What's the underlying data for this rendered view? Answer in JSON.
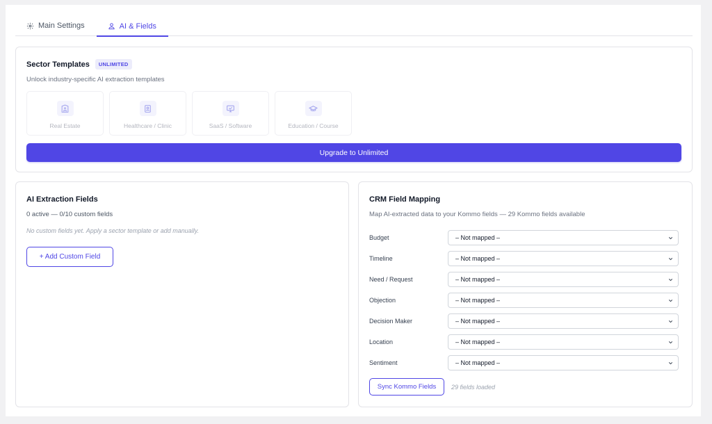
{
  "tabs": [
    {
      "label": "Main Settings",
      "icon": "gear-icon",
      "active": false
    },
    {
      "label": "AI & Fields",
      "icon": "user-icon",
      "active": true
    }
  ],
  "sector_templates": {
    "title": "Sector Templates",
    "badge": "UNLIMITED",
    "subtitle": "Unlock industry-specific AI extraction templates",
    "templates": [
      {
        "label": "Real Estate",
        "icon": "building-icon"
      },
      {
        "label": "Healthcare / Clinic",
        "icon": "medical-badge-icon"
      },
      {
        "label": "SaaS / Software",
        "icon": "monitor-icon"
      },
      {
        "label": "Education / Course",
        "icon": "graduation-cap-icon"
      }
    ],
    "upgrade_label": "Upgrade to Unlimited"
  },
  "ai_extraction": {
    "title": "AI Extraction Fields",
    "meta": "0 active — 0/10 custom fields",
    "empty_text": "No custom fields yet. Apply a sector template or add manually.",
    "add_label": "+ Add Custom Field"
  },
  "crm_mapping": {
    "title": "CRM Field Mapping",
    "subtitle": "Map AI-extracted data to your Kommo fields — 29 Kommo fields available",
    "rows": [
      {
        "label": "Budget",
        "value": "– Not mapped –"
      },
      {
        "label": "Timeline",
        "value": "– Not mapped –"
      },
      {
        "label": "Need / Request",
        "value": "– Not mapped –"
      },
      {
        "label": "Objection",
        "value": "– Not mapped –"
      },
      {
        "label": "Decision Maker",
        "value": "– Not mapped –"
      },
      {
        "label": "Location",
        "value": "– Not mapped –"
      },
      {
        "label": "Sentiment",
        "value": "– Not mapped –"
      }
    ],
    "sync_label": "Sync Kommo Fields",
    "sync_note": "29 fields loaded"
  },
  "colors": {
    "accent": "#4f46e5",
    "accent_button": "#5046e5",
    "border": "#e3e3e8",
    "background": "#f1f1f3"
  }
}
